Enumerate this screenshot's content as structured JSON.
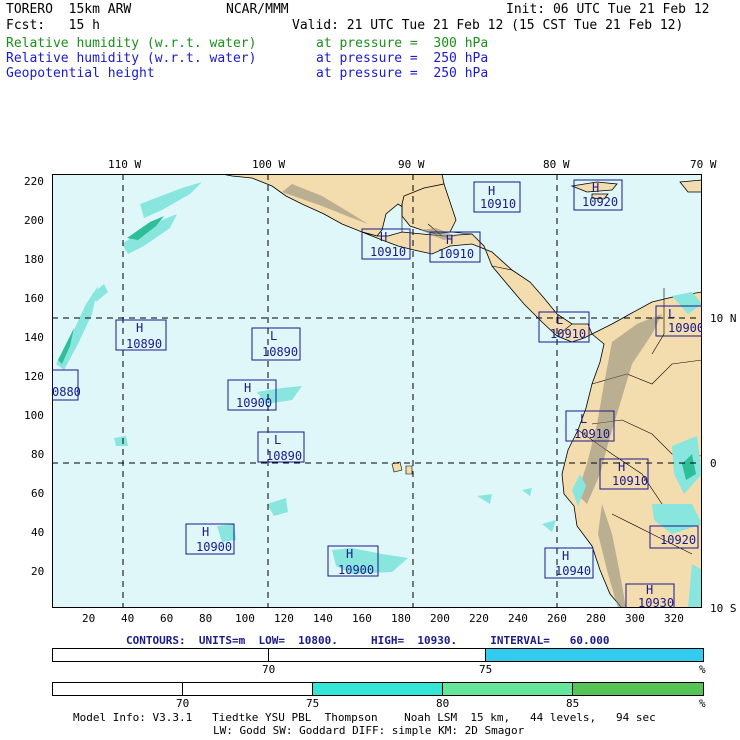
{
  "header": {
    "model": "TORERO  15km ARW",
    "agency": "NCAR/MMM",
    "init": "Init: 06 UTC Tue 21 Feb 12",
    "fcst": "Fcst:   15 h",
    "valid": "Valid: 21 UTC Tue 21 Feb 12 (15 CST Tue 21 Feb 12)",
    "fields": [
      {
        "name": "Relative humidity (w.r.t. water)",
        "level": "at pressure =  300 hPa",
        "color": "#1a8f1a"
      },
      {
        "name": "Relative humidity (w.r.t. water)",
        "level": "at pressure =  250 hPa",
        "color": "#1a1ad0"
      },
      {
        "name": "Geopotential height",
        "level": "at pressure =  250 hPa",
        "color": "#1a1ad0"
      }
    ]
  },
  "map": {
    "colors": {
      "ocean": "#dff7f9",
      "land": "#f3dcae",
      "moist_light": "#88e6df",
      "moist_dark": "#2ebf9a",
      "box": "#1a1a8a"
    },
    "top_labels": [
      "110 W",
      "100 W",
      "90 W",
      "80 W",
      "70 W"
    ],
    "right_labels": [
      "10 N",
      "0",
      "10 S"
    ],
    "left_labels": [
      "220",
      "200",
      "180",
      "160",
      "140",
      "120",
      "100",
      "80",
      "60",
      "40",
      "20"
    ],
    "bottom_labels": [
      "20",
      "40",
      "60",
      "80",
      "100",
      "120",
      "140",
      "160",
      "180",
      "200",
      "220",
      "240",
      "260",
      "280",
      "300",
      "320"
    ],
    "centers": [
      {
        "type": "H",
        "value": "10910"
      },
      {
        "type": "H",
        "value": "10920"
      },
      {
        "type": "H",
        "value": "10910"
      },
      {
        "type": "H",
        "value": "10910"
      },
      {
        "type": "L",
        "value": "10910"
      },
      {
        "type": "L",
        "value": "10900"
      },
      {
        "type": "H",
        "value": "10890"
      },
      {
        "type": "L",
        "value": "10890"
      },
      {
        "type": "H",
        "value": "10900"
      },
      {
        "type": "L",
        "value": "10890"
      },
      {
        "type": "L",
        "value": "10910"
      },
      {
        "type": "H",
        "value": "10910"
      },
      {
        "type": "H",
        "value": "10900"
      },
      {
        "type": "H",
        "value": "10900"
      },
      {
        "type": "H",
        "value": "10940"
      },
      {
        "type": "",
        "value": "10920"
      },
      {
        "type": "H",
        "value": "10930"
      },
      {
        "type": "",
        "value": "0880"
      }
    ]
  },
  "contour_info": "CONTOURS:  UNITS=m  LOW=  10800.     HIGH=  10930.     INTERVAL=   60.000",
  "colorbar1": {
    "labels": [
      "70",
      "75"
    ],
    "unit": "%",
    "colors": [
      "#ffffff",
      "#ffffff",
      "#33ccee"
    ]
  },
  "colorbar2": {
    "labels": [
      "70",
      "75",
      "80",
      "85"
    ],
    "unit": "%",
    "colors": [
      "#ffffff",
      "#ffffff",
      "#33e6d6",
      "#66e69a",
      "#55c455"
    ]
  },
  "footer": {
    "line1": "Model Info: V3.3.1   Tiedtke YSU PBL  Thompson    Noah LSM  15 km,   44 levels,   94 sec",
    "line2": "LW: Godd SW: Goddard DIFF: simple KM: 2D Smagor"
  }
}
